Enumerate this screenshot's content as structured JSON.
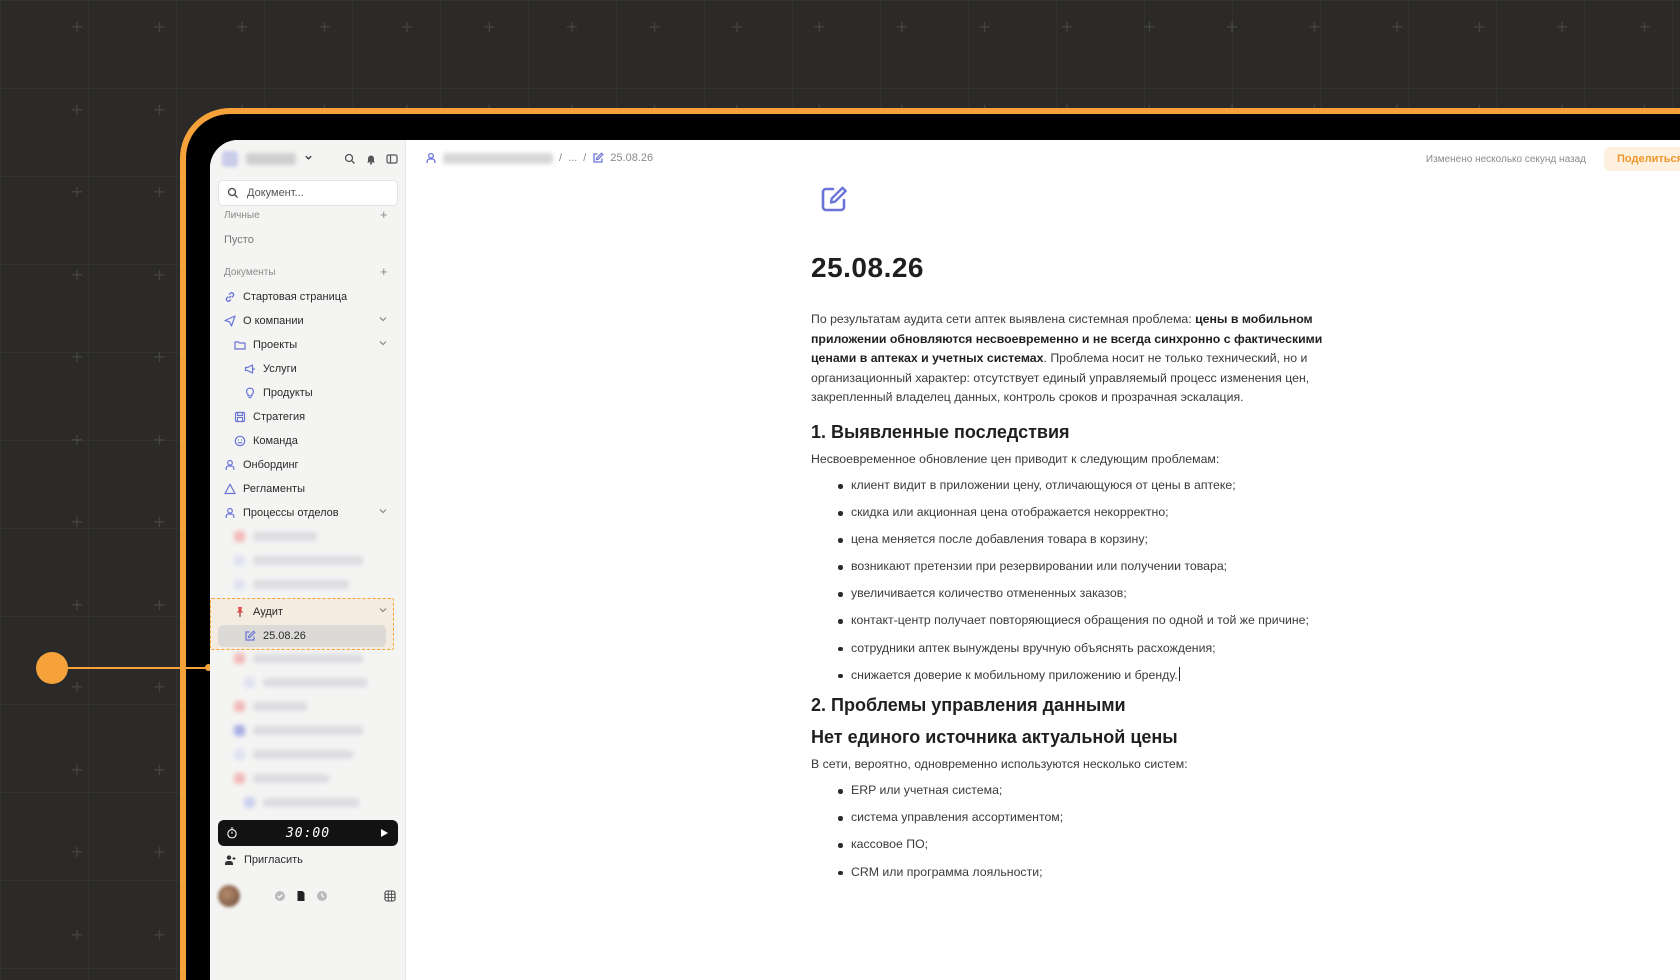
{
  "colors": {
    "accent": "#f5a23a",
    "primary_icon": "#6a74d8",
    "active_item_bg": "#dcdad6"
  },
  "sidebar": {
    "search_placeholder": "Документ...",
    "personal_label": "Личные",
    "personal_empty": "Пусто",
    "documents_label": "Документы",
    "items": [
      {
        "label": "Стартовая страница",
        "icon": "link-icon"
      },
      {
        "label": "О компании",
        "icon": "send-icon"
      },
      {
        "label": "Проекты",
        "icon": "folder-icon"
      },
      {
        "label": "Услуги",
        "icon": "megaphone-icon"
      },
      {
        "label": "Продукты",
        "icon": "bulb-icon"
      },
      {
        "label": "Стратегия",
        "icon": "save-icon"
      },
      {
        "label": "Команда",
        "icon": "smile-icon"
      },
      {
        "label": "Онбординг",
        "icon": "person-icon"
      },
      {
        "label": "Регламенты",
        "icon": "warning-icon"
      },
      {
        "label": "Процессы отделов",
        "icon": "person-icon"
      },
      {
        "label": "Аудит",
        "icon": "pushpin-icon"
      },
      {
        "label": "25.08.26",
        "icon": "edit-icon"
      }
    ],
    "timer": "30:00",
    "invite_label": "Пригласить"
  },
  "topbar": {
    "breadcrumb_ellipsis": "...",
    "breadcrumb_current": "25.08.26",
    "status": "Изменено несколько секунд назад",
    "share_label": "Поделиться"
  },
  "document": {
    "title": "25.08.26",
    "intro_plain_1": "По результатам аудита сети аптек выявлена системная проблема: ",
    "intro_bold": "цены в мобильном приложении обновляются несвоевременно и не всегда синхронно с фактическими ценами в аптеках и учетных системах",
    "intro_plain_2": ". Проблема носит не только технический, но и организационный характер: отсутствует единый управляемый процесс изменения цен, закрепленный владелец данных, контроль сроков и прозрачная эскалация.",
    "section1_title": "1. Выявленные последствия",
    "section1_lead": "Несвоевременное обновление цен приводит к следующим проблемам:",
    "section1_items": [
      "клиент видит в приложении цену, отличающуюся от цены в аптеке;",
      "скидка или акционная цена отображается некорректно;",
      "цена меняется после добавления товара в корзину;",
      "возникают претензии при резервировании или получении товара;",
      "увеличивается количество отмененных заказов;",
      "контакт-центр получает повторяющиеся обращения по одной и той же причине;",
      "сотрудники аптек вынуждены вручную объяснять расхождения;",
      "снижается доверие к мобильному приложению и бренду."
    ],
    "section2_title": "2. Проблемы управления данными",
    "section2_sub": "Нет единого источника актуальной цены",
    "section2_lead": "В сети, вероятно, одновременно используются несколько систем:",
    "section2_items": [
      "ERP или учетная система;",
      "система управления ассортиментом;",
      "кассовое ПО;",
      "CRM или программа лояльности;"
    ]
  }
}
